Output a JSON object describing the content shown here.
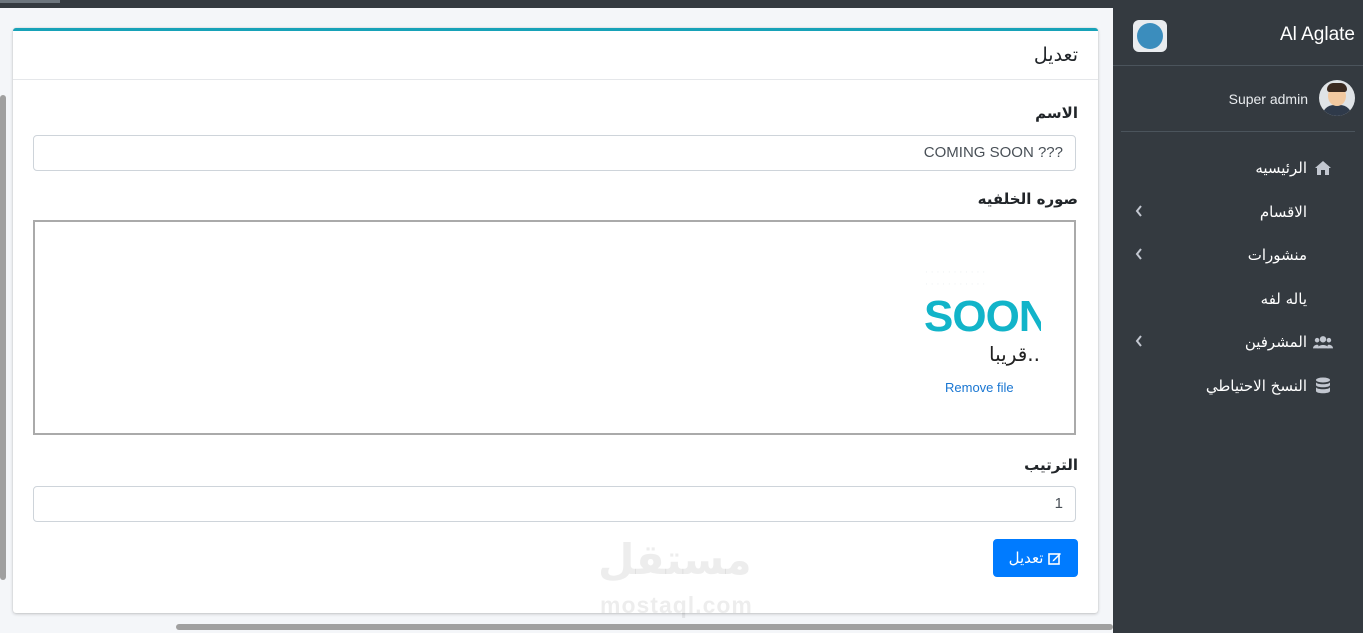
{
  "sidebar": {
    "brand": "Al Aglate",
    "user": "Super admin",
    "items": [
      {
        "label": "الرئيسيه",
        "icon": "home-icon",
        "chevron": false
      },
      {
        "label": "الاقسام",
        "icon": "",
        "chevron": true
      },
      {
        "label": "منشورات",
        "icon": "",
        "chevron": true
      },
      {
        "label": "ياله لفه",
        "icon": "",
        "chevron": false
      },
      {
        "label": "المشرفين",
        "icon": "users-icon",
        "chevron": true
      },
      {
        "label": "النسخ الاحتياطي",
        "icon": "database-icon",
        "chevron": false
      }
    ]
  },
  "card": {
    "title": "تعديل",
    "name_label": "الاسم",
    "name_value": "??? COMING SOON",
    "image_label": "صوره الخلفيه",
    "preview_text": "SOON",
    "preview_arabic": "...قريبا",
    "remove_link": "Remove file",
    "order_label": "الترتيب",
    "order_value": "1",
    "submit_label": "تعديل"
  },
  "watermark": {
    "arabic": "مستقل",
    "latin": "mostaql.com"
  },
  "colors": {
    "sidebar_bg": "#343a40",
    "accent": "#17a2b8",
    "primary": "#007bff"
  }
}
